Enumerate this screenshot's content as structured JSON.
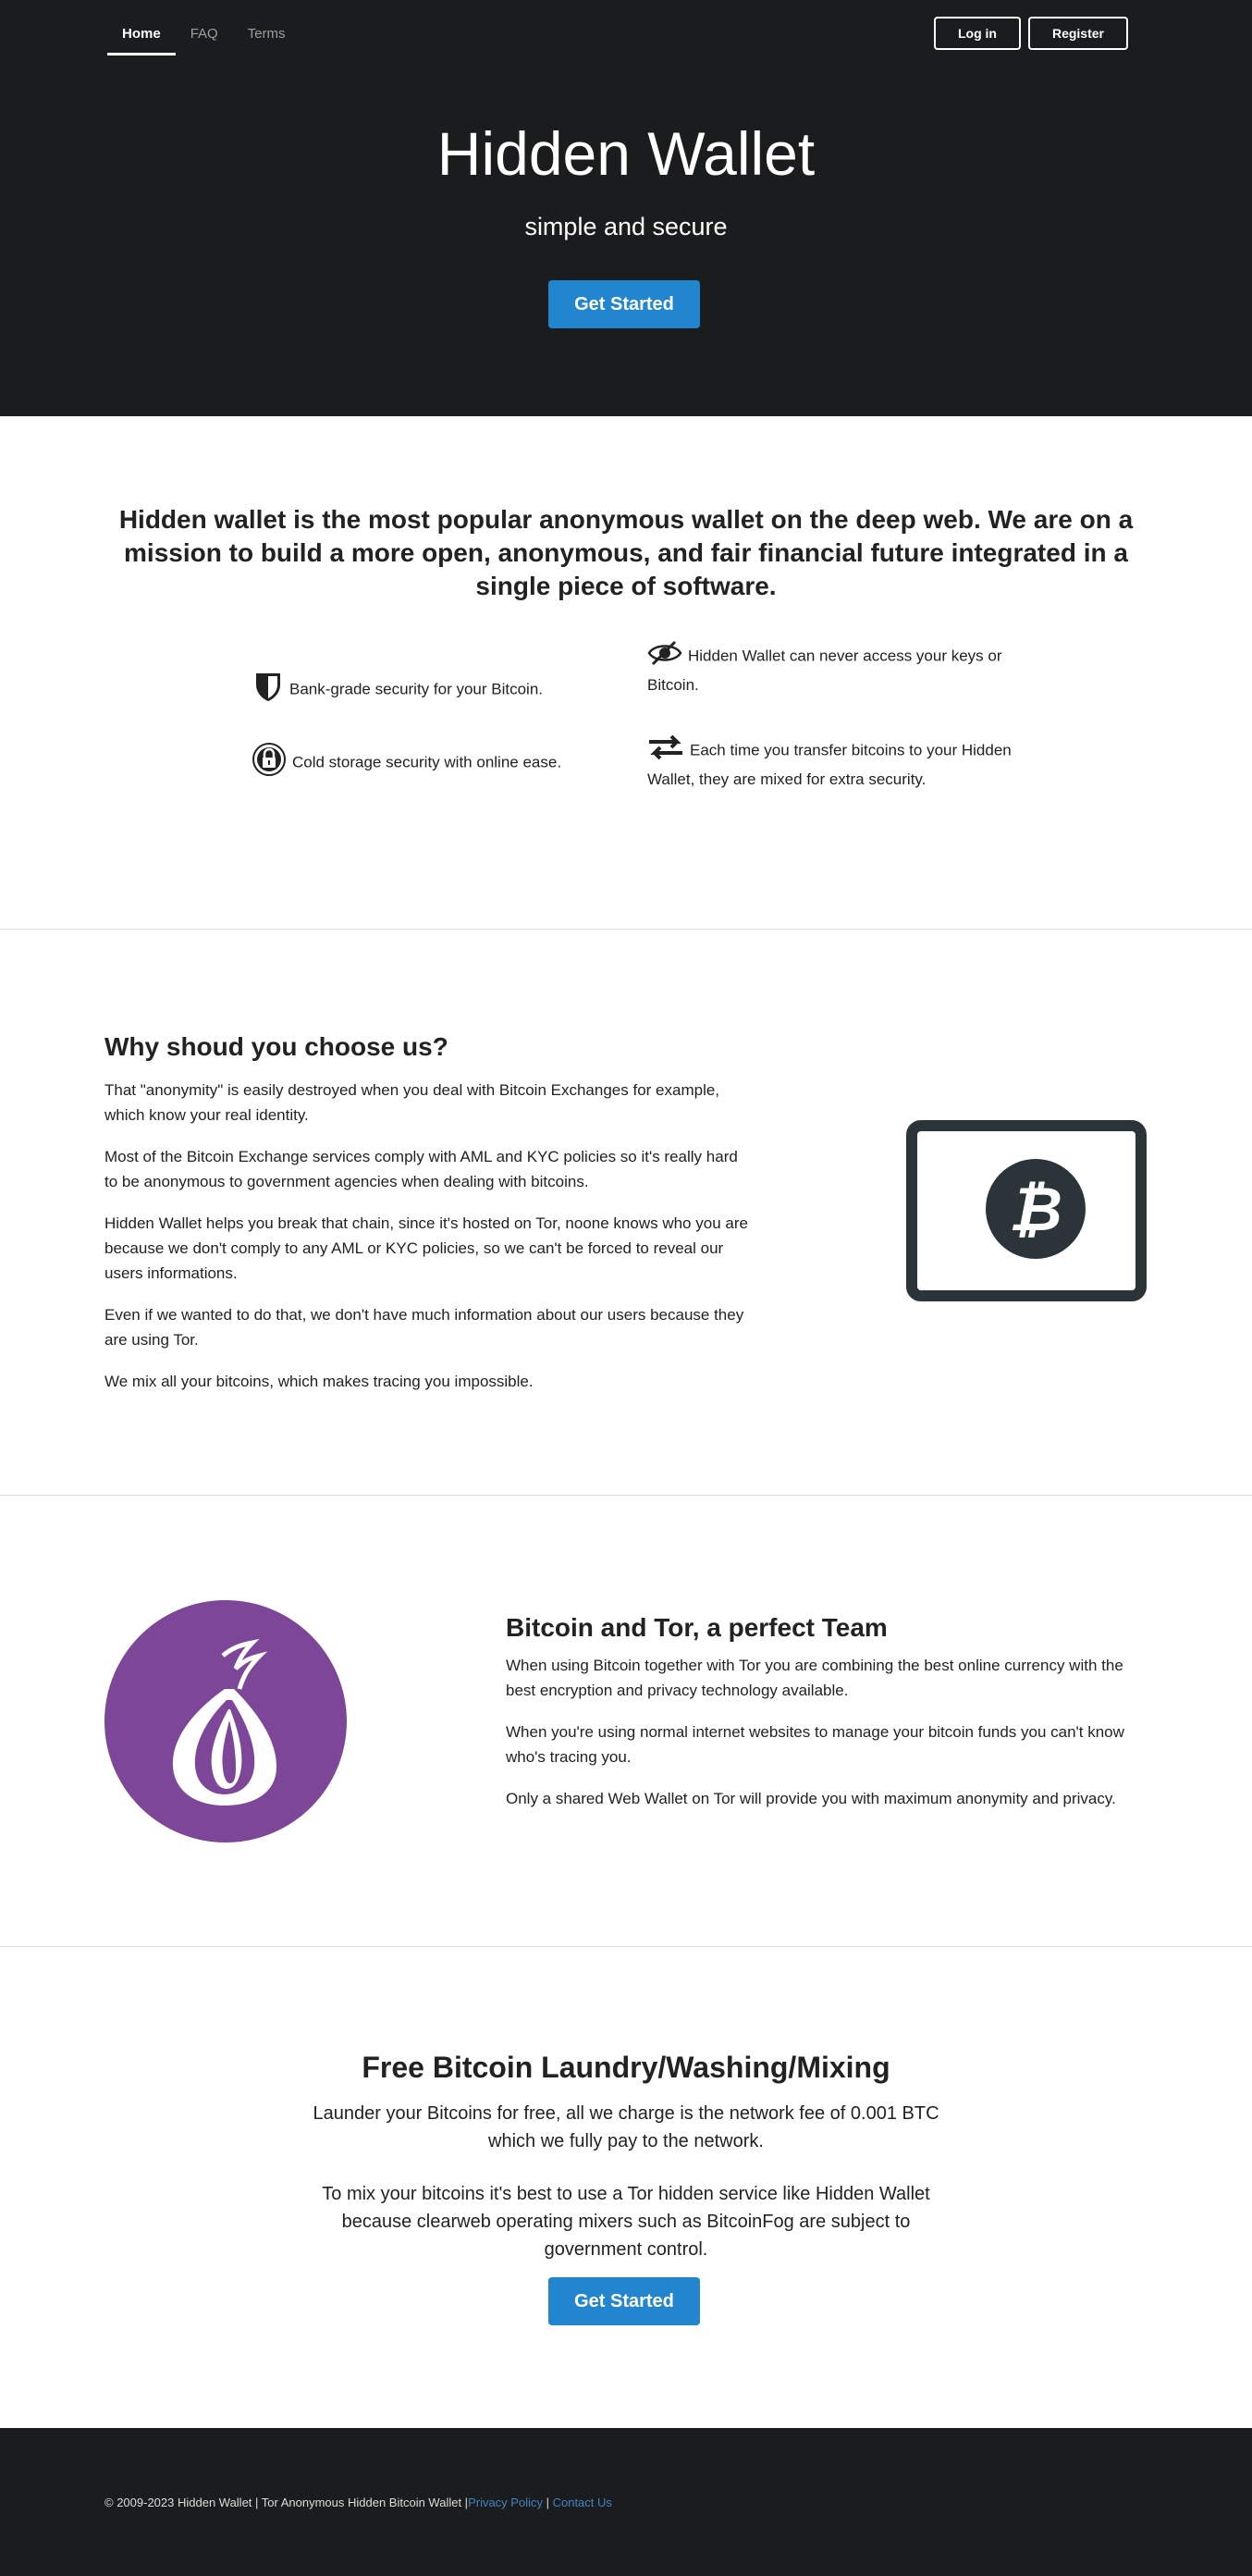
{
  "nav": {
    "items": [
      {
        "label": "Home",
        "active": true
      },
      {
        "label": "FAQ",
        "active": false
      },
      {
        "label": "Terms",
        "active": false
      }
    ],
    "login_label": "Log in",
    "register_label": "Register"
  },
  "hero": {
    "title": "Hidden Wallet",
    "subtitle": "simple and secure",
    "cta_label": "Get Started"
  },
  "intro": {
    "heading": "Hidden wallet is the most popular anonymous wallet on the deep web. We are on a mission to build a more open, anonymous, and fair financial future integrated in a single piece of software.",
    "features": [
      {
        "icon": "shield-icon",
        "text": "Bank-grade security for your Bitcoin."
      },
      {
        "icon": "lock-icon",
        "text": "Cold storage security with online ease."
      },
      {
        "icon": "eye-slash-icon",
        "text": "Hidden Wallet can never access your keys or Bitcoin."
      },
      {
        "icon": "exchange-icon",
        "text": "Each time you transfer bitcoins to your Hidden Wallet, they are mixed for extra security."
      }
    ]
  },
  "why": {
    "heading": "Why shoud you choose us?",
    "paragraphs": [
      "That \"anonymity\" is easily destroyed when you deal with Bitcoin Exchanges for example, which know your real identity.",
      "Most of the Bitcoin Exchange services comply with AML and KYC policies so it's really hard to be anonymous to government agencies when dealing with bitcoins.",
      "Hidden Wallet helps you break that chain, since it's hosted on Tor, noone knows who you are because we don't comply to any AML or KYC policies, so we can't be forced to reveal our users informations.",
      "Even if we wanted to do that, we don't have much information about our users because they are using Tor.",
      "We mix all your bitcoins, which makes tracing you impossible."
    ],
    "image_icon": "bitcoin-card-icon"
  },
  "tor": {
    "heading": "Bitcoin and Tor, a perfect Team",
    "paragraphs": [
      "When using Bitcoin together with Tor you are combining the best online currency with the best encryption and privacy technology available.",
      "When you're using normal internet websites to manage your bitcoin funds you can't know who's tracing you.",
      "Only a shared Web Wallet on Tor will provide you with maximum anonymity and privacy."
    ],
    "logo_icon": "tor-onion-icon",
    "logo_color": "#7d4698"
  },
  "laundry": {
    "heading": "Free Bitcoin Laundry/Washing/Mixing",
    "p1": "Launder your Bitcoins for free, all we charge is the network fee of 0.001 BTC which we fully pay to the network.",
    "p2": "To mix your bitcoins it's best to use a Tor hidden service like Hidden Wallet because clearweb operating mixers such as BitcoinFog are subject to government control.",
    "cta_label": "Get Started"
  },
  "footer": {
    "copyright": "© 2009-2023 Hidden Wallet | Tor Anonymous Hidden Bitcoin Wallet |",
    "privacy_label": "Privacy Policy",
    "separator": " | ",
    "contact_label": "Contact Us"
  },
  "colors": {
    "dark_bg": "#1b1c1d",
    "accent": "#2185d0",
    "link": "#4183c4",
    "tor_purple": "#7d4698"
  }
}
